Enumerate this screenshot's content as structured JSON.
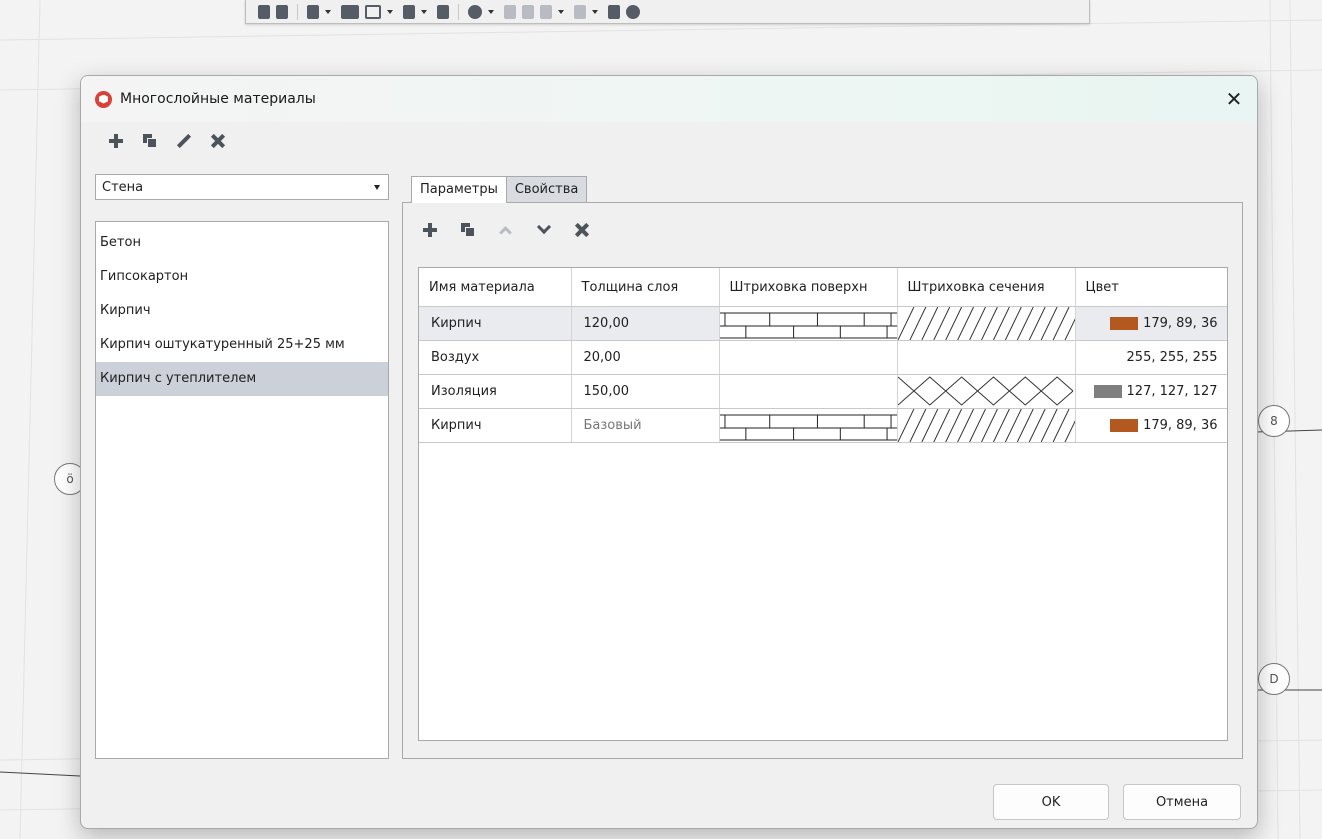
{
  "dialog": {
    "title": "Многослойные материалы",
    "close_glyph": "✕"
  },
  "left_panel": {
    "type_select": {
      "value": "Стена"
    },
    "materials": [
      {
        "label": "Бетон"
      },
      {
        "label": "Гипсокартон"
      },
      {
        "label": "Кирпич"
      },
      {
        "label": "Кирпич оштукатуренный 25+25 мм"
      },
      {
        "label": "Кирпич с утеплителем",
        "selected": true
      }
    ]
  },
  "tabs": [
    {
      "label": "Параметры",
      "active": true
    },
    {
      "label": "Свойства",
      "active": false
    }
  ],
  "layer_table": {
    "columns": [
      "Имя материала",
      "Толщина слоя",
      "Штриховка поверхн",
      "Штриховка сечения",
      "Цвет"
    ],
    "rows": [
      {
        "name": "Кирпич",
        "thickness": "120,00",
        "surface_hatch": "brick-pattern",
        "section_hatch": "diagonal-hatch",
        "color": "179, 89, 36",
        "swatch": "#b3591f"
      },
      {
        "name": "Воздух",
        "thickness": "20,00",
        "surface_hatch": "none",
        "section_hatch": "none",
        "color": "255, 255, 255",
        "swatch": ""
      },
      {
        "name": "Изоляция",
        "thickness": "150,00",
        "surface_hatch": "none",
        "section_hatch": "cross-hatch",
        "color": "127, 127, 127",
        "swatch": "#7f7f7f"
      },
      {
        "name": "Кирпич",
        "thickness": "Базовый",
        "surface_hatch": "brick-pattern",
        "section_hatch": "diagonal-hatch",
        "color": "179, 89, 36",
        "swatch": "#b3591f"
      }
    ]
  },
  "footer": {
    "ok_label": "OK",
    "cancel_label": "Отмена"
  },
  "canvas": {
    "bubbles": [
      "ö",
      "8",
      "D"
    ]
  },
  "colors": {
    "accent_selected": "#ccd1d9",
    "brick": "#b3591f",
    "insulation": "#7f7f7f"
  }
}
